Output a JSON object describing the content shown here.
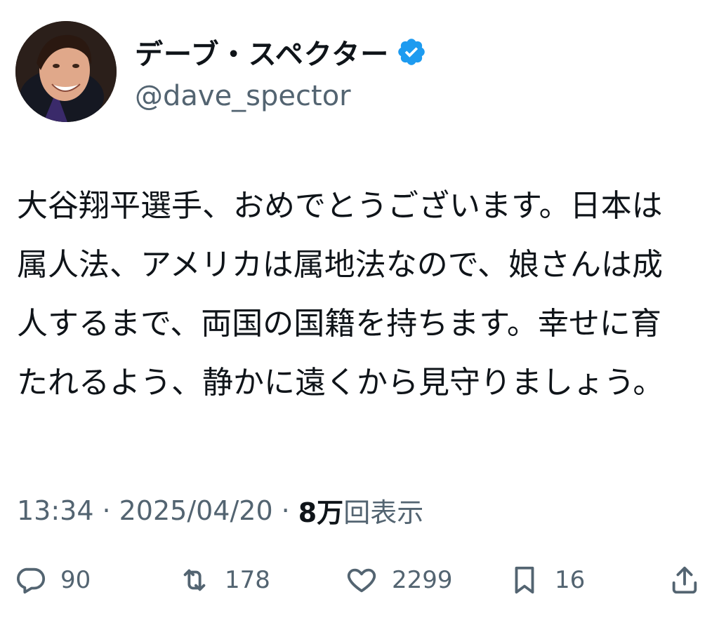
{
  "author": {
    "display_name": "デーブ・スペクター",
    "handle": "@dave_spector",
    "verified": true,
    "verified_color": "#1d9bf0"
  },
  "tweet": {
    "text": "大谷翔平選手、おめでとうございます。日本は属人法、アメリカは属地法なので、娘さんは成人するまで、両国の国籍を持ちます。幸せに育たれるよう、静かに遠くから見守りましょう。",
    "time": "13:34",
    "separator": "·",
    "date": "2025/04/20",
    "views_count": "8万",
    "views_label": "回表示"
  },
  "actions": {
    "replies": {
      "icon": "reply-icon",
      "count": "90"
    },
    "retweets": {
      "icon": "retweet-icon",
      "count": "178"
    },
    "likes": {
      "icon": "heart-icon",
      "count": "2299"
    },
    "bookmarks": {
      "icon": "bookmark-icon",
      "count": "16"
    },
    "share": {
      "icon": "share-icon"
    }
  },
  "colors": {
    "text_primary": "#0f1419",
    "text_secondary": "#536471",
    "accent": "#1d9bf0"
  }
}
